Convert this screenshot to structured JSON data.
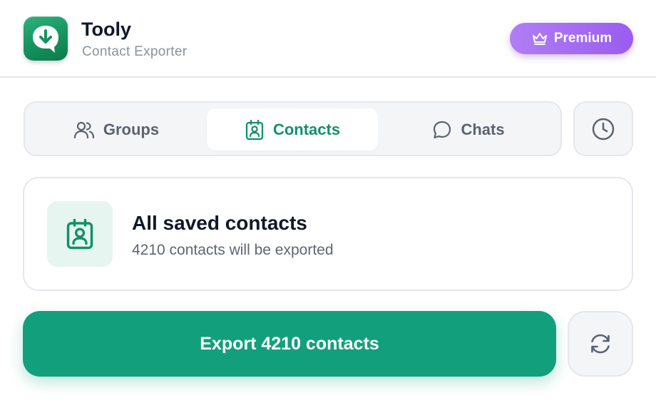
{
  "app": {
    "title": "Tooly",
    "subtitle": "Contact Exporter",
    "logo_icon": "download-chat-icon",
    "brand_color": "#15935f"
  },
  "premium": {
    "label": "Premium",
    "icon": "crown-icon",
    "color": "#9a5cf0"
  },
  "tabs": [
    {
      "label": "Groups",
      "icon": "users-icon",
      "active": false
    },
    {
      "label": "Contacts",
      "icon": "contact-badge-icon",
      "active": true
    },
    {
      "label": "Chats",
      "icon": "chat-bubble-icon",
      "active": false
    }
  ],
  "history_button": {
    "icon": "clock-icon"
  },
  "summary": {
    "title": "All saved contacts",
    "subtitle": "4210 contacts will be exported",
    "icon": "contact-badge-icon"
  },
  "export_button": {
    "label": "Export 4210 contacts",
    "color": "#12a07c"
  },
  "refresh_button": {
    "icon": "refresh-icon"
  }
}
